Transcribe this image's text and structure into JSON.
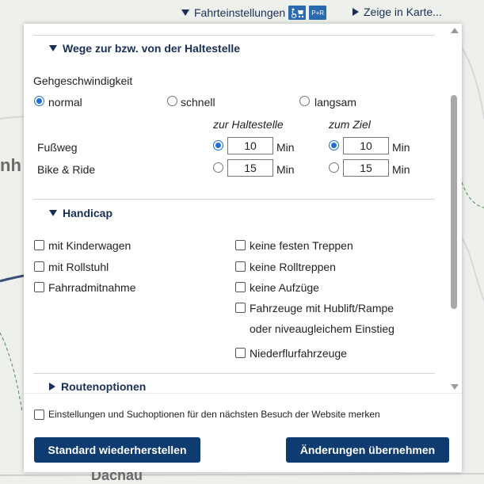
{
  "topbar": {
    "settings_label": "Fahrteinstellungen",
    "accessibility_badge": "",
    "pr_badge": "P+R",
    "map_label": "Zeige in Karte..."
  },
  "map": {
    "label_left": "nh",
    "label_bottom": "Dachau"
  },
  "section_wege": {
    "title": "Wege zur bzw. von der Haltestelle",
    "walking_speed_label": "Gehgeschwindigkeit",
    "speeds": [
      {
        "label": "normal",
        "selected": true
      },
      {
        "label": "schnell",
        "selected": false
      },
      {
        "label": "langsam",
        "selected": false
      }
    ],
    "col_to_stop": "zur Haltestelle",
    "col_to_dest": "zum Ziel",
    "unit": "Min",
    "rows": [
      {
        "label": "Fußweg",
        "to_stop": "10",
        "to_dest": "10",
        "selected": true
      },
      {
        "label": "Bike & Ride",
        "to_stop": "15",
        "to_dest": "15",
        "selected": false
      }
    ]
  },
  "section_handicap": {
    "title": "Handicap",
    "left_options": [
      "mit Kinderwagen",
      "mit Rollstuhl",
      "Fahrradmitnahme"
    ],
    "right_options": [
      "keine festen Treppen",
      "keine Rolltreppen",
      "keine Aufzüge"
    ],
    "lift_option_line1": "Fahrzeuge mit Hublift/Rampe",
    "lift_option_line2": "oder niveaugleichem Einstieg",
    "low_floor": "Niederflurfahrzeuge"
  },
  "section_routen": {
    "title": "Routenoptionen"
  },
  "footer": {
    "remember_label": "Einstellungen und Suchoptionen für den nächsten Besuch der Website merken",
    "reset_label": "Standard wiederherstellen",
    "apply_label": "Änderungen übernehmen"
  },
  "colors": {
    "accent": "#0e3c70",
    "radio": "#1f6fd6"
  }
}
